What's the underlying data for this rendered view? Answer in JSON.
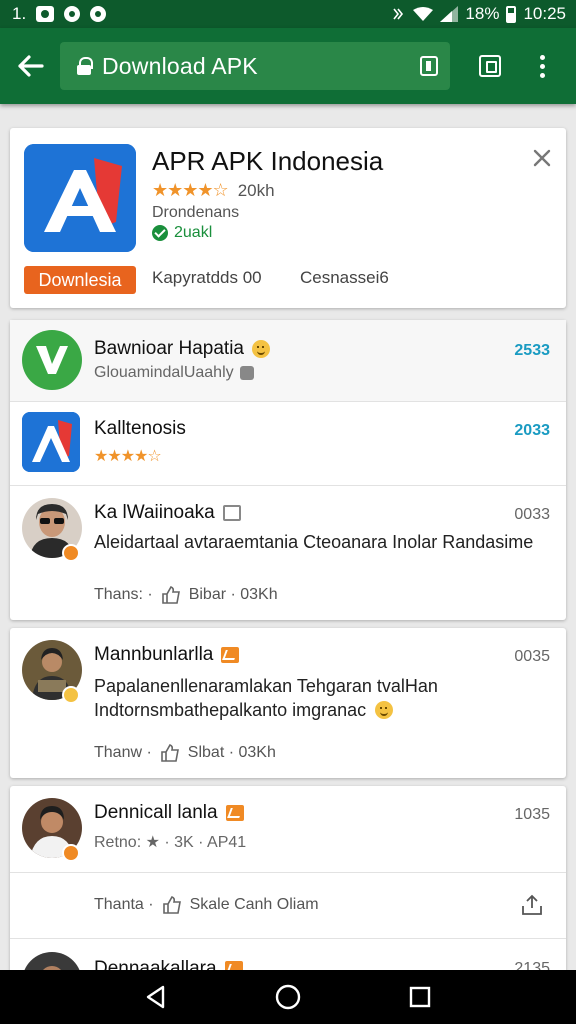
{
  "status_bar": {
    "left_text": "1.",
    "battery_text": "18%",
    "time": "10:25"
  },
  "toolbar": {
    "url_text": "Download APK"
  },
  "app_card": {
    "title": "APR APK Indonesia",
    "stars": "★★★★☆",
    "rating_count": "20kh",
    "developer": "Drondenans",
    "verified_text": "2uakl",
    "download_label": "Downlesia",
    "meta1": "Kapyratdds 00",
    "meta2": "Cesnassei6"
  },
  "list": [
    {
      "title": "Bawnioar Hapatia",
      "subtitle": "GlouamindalUaahly",
      "time": "2533"
    },
    {
      "title": "Kalltenosis",
      "stars": "★★★★☆",
      "time": "2033"
    },
    {
      "title": "Ka lWaiinoaka",
      "body": "Aleidartaal avtaraemtania Cteoanara Inolar Randasime",
      "action_left": "Thans: ·",
      "action_right": "Bibar · 03Kh",
      "time": "0033"
    }
  ],
  "posts": [
    {
      "title": "Mannbunlarlla",
      "body": "Papalanenllenaramlakan Tehgaran tvalHan Indtornsmbathepalkanto imgranac",
      "action_left": "Thanw ·",
      "action_right": "Slbat · 03Kh",
      "time": "0035"
    },
    {
      "title": "Dennicall lanla",
      "subtitle": "Retno: ★ · 3K · AP41",
      "action_left": "Thanta ·",
      "action_right": "Skale Canh Oliam",
      "time": "1035"
    },
    {
      "title": "Dennaakallara",
      "time": "2135"
    }
  ],
  "colors": {
    "status_bar": "#0d5a2c",
    "toolbar": "#0f6e36",
    "url_bar": "#2a8748",
    "accent_orange": "#e8641e",
    "accent_blue": "#1a9bc2",
    "star": "#f0932a"
  }
}
